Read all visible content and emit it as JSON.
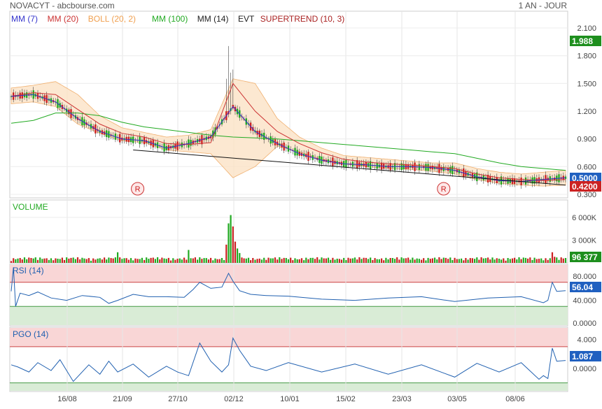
{
  "header": {
    "title": "NOVACYT - abcbourse.com",
    "period": "1 AN - JOUR"
  },
  "indicators": [
    {
      "label": "MM (7)",
      "color": "#3333cc"
    },
    {
      "label": "MM (20)",
      "color": "#cc3333"
    },
    {
      "label": "BOLL (20, 2)",
      "color": "#f0a050"
    },
    {
      "label": "MM (100)",
      "color": "#22aa22"
    },
    {
      "label": "MM (14)",
      "color": "#222222"
    },
    {
      "label": "EVT",
      "color": "#222222"
    },
    {
      "label": "SUPERTREND (10, 3)",
      "color": "#aa2222"
    }
  ],
  "markers": {
    "r_label": "R"
  },
  "chart_data": [
    {
      "type": "line",
      "panel": "price",
      "x_ticks": [
        "16/08",
        "21/09",
        "27/10",
        "02/12",
        "10/01",
        "15/02",
        "23/03",
        "03/05",
        "08/06"
      ],
      "y_ticks": [
        "2.100",
        "1.800",
        "1.500",
        "1.200",
        "0.900",
        "0.600",
        "0.300"
      ],
      "ylim": [
        0.3,
        2.1
      ],
      "last_badges": [
        {
          "value": "1.988",
          "color": "#1e8f1e"
        },
        {
          "value": "0.5000",
          "color": "#2060c0"
        },
        {
          "value": "0.4200",
          "color": "#cc2222"
        }
      ],
      "series": [
        {
          "name": "MM (7)",
          "x": [
            0,
            10,
            20,
            30,
            40,
            50,
            60,
            70,
            80,
            90,
            100,
            110,
            120,
            130,
            140,
            150,
            160,
            170,
            180,
            190,
            200,
            210,
            220,
            230,
            240,
            250
          ],
          "values": [
            1.36,
            1.38,
            1.3,
            1.12,
            0.98,
            0.9,
            0.88,
            0.8,
            0.85,
            0.92,
            1.25,
            0.98,
            0.85,
            0.74,
            0.67,
            0.63,
            0.62,
            0.6,
            0.6,
            0.59,
            0.56,
            0.49,
            0.45,
            0.44,
            0.46,
            0.48
          ]
        },
        {
          "name": "MM (20)",
          "x": [
            0,
            10,
            20,
            30,
            40,
            50,
            60,
            70,
            80,
            90,
            100,
            110,
            120,
            130,
            140,
            150,
            160,
            170,
            180,
            190,
            200,
            210,
            220,
            230,
            240,
            250
          ],
          "values": [
            1.36,
            1.4,
            1.38,
            1.22,
            1.06,
            0.96,
            0.92,
            0.85,
            0.84,
            0.86,
            1.5,
            1.2,
            0.98,
            0.85,
            0.75,
            0.68,
            0.65,
            0.63,
            0.62,
            0.6,
            0.58,
            0.52,
            0.48,
            0.46,
            0.45,
            0.46
          ]
        },
        {
          "name": "MM (100)",
          "x": [
            0,
            10,
            20,
            30,
            40,
            50,
            60,
            70,
            80,
            90,
            100,
            110,
            120,
            130,
            140,
            150,
            160,
            170,
            180,
            190,
            200,
            210,
            220,
            230,
            240,
            250
          ],
          "values": [
            1.07,
            1.1,
            1.18,
            1.18,
            1.15,
            1.08,
            1.03,
            1.0,
            0.97,
            0.94,
            0.92,
            0.91,
            0.9,
            0.88,
            0.86,
            0.84,
            0.82,
            0.8,
            0.78,
            0.76,
            0.74,
            0.69,
            0.64,
            0.6,
            0.58,
            0.56
          ]
        },
        {
          "name": "BOLL upper",
          "x": [
            0,
            10,
            20,
            30,
            40,
            50,
            60,
            70,
            80,
            90,
            100,
            110,
            120,
            130,
            140,
            150,
            160,
            170,
            180,
            190,
            200,
            210,
            220,
            230,
            240,
            250
          ],
          "values": [
            1.45,
            1.48,
            1.52,
            1.38,
            1.15,
            1.02,
            0.97,
            0.92,
            0.94,
            1.0,
            1.55,
            1.5,
            1.12,
            0.92,
            0.8,
            0.72,
            0.7,
            0.68,
            0.66,
            0.64,
            0.64,
            0.58,
            0.54,
            0.52,
            0.54,
            0.56
          ]
        },
        {
          "name": "BOLL lower",
          "x": [
            0,
            10,
            20,
            30,
            40,
            50,
            60,
            70,
            80,
            90,
            100,
            110,
            120,
            130,
            140,
            150,
            160,
            170,
            180,
            190,
            200,
            210,
            220,
            230,
            240,
            250
          ],
          "values": [
            1.28,
            1.3,
            1.25,
            1.06,
            0.96,
            0.88,
            0.86,
            0.78,
            0.76,
            0.74,
            0.48,
            0.6,
            0.82,
            0.76,
            0.68,
            0.63,
            0.6,
            0.58,
            0.57,
            0.55,
            0.52,
            0.46,
            0.42,
            0.4,
            0.39,
            0.4
          ]
        },
        {
          "name": "Trend",
          "x": [
            55,
            250
          ],
          "values": [
            0.78,
            0.4
          ]
        }
      ]
    },
    {
      "type": "bar",
      "panel": "volume",
      "title": "VOLUME",
      "y_ticks": [
        "6 000K",
        "3 000K"
      ],
      "ylim": [
        0,
        7000
      ],
      "last_value": "96 377",
      "last_color": "#1e8f1e",
      "spikes": [
        {
          "x": 48,
          "value": 1400
        },
        {
          "x": 97,
          "value": 2400
        },
        {
          "x": 98,
          "value": 5200
        },
        {
          "x": 99,
          "value": 6300
        },
        {
          "x": 100,
          "value": 4800
        },
        {
          "x": 101,
          "value": 2800
        },
        {
          "x": 102,
          "value": 1900
        },
        {
          "x": 103,
          "value": 1300
        },
        {
          "x": 80,
          "value": 1700
        },
        {
          "x": 244,
          "value": 1400
        },
        {
          "x": 245,
          "value": 800
        }
      ]
    },
    {
      "type": "line",
      "panel": "rsi",
      "title": "RSI (14)",
      "y_ticks": [
        "80.000",
        "40.000",
        "0.0000"
      ],
      "ylim": [
        0,
        100
      ],
      "levels": [
        70,
        30
      ],
      "last_value": "56.04",
      "last_color": "#2060c0",
      "x": [
        0,
        1,
        2,
        4,
        8,
        12,
        18,
        25,
        32,
        40,
        44,
        48,
        55,
        62,
        70,
        78,
        82,
        85,
        90,
        95,
        98,
        100,
        103,
        108,
        115,
        125,
        140,
        155,
        170,
        185,
        200,
        215,
        230,
        240,
        242,
        244,
        246,
        250
      ],
      "values": [
        55,
        95,
        30,
        52,
        48,
        54,
        44,
        40,
        48,
        45,
        35,
        40,
        50,
        46,
        46,
        45,
        58,
        70,
        60,
        62,
        85,
        72,
        56,
        50,
        48,
        47,
        42,
        40,
        44,
        46,
        38,
        44,
        46,
        36,
        40,
        70,
        55,
        56
      ]
    },
    {
      "type": "line",
      "panel": "pgo",
      "title": "PGO (14)",
      "y_ticks": [
        "4.000",
        "0.0000"
      ],
      "ylim": [
        -3,
        5.5
      ],
      "levels": [
        3,
        -2
      ],
      "last_value": "1.087",
      "last_color": "#2060c0",
      "x": [
        0,
        3,
        8,
        12,
        18,
        22,
        28,
        35,
        40,
        44,
        48,
        55,
        62,
        70,
        75,
        80,
        85,
        90,
        95,
        98,
        100,
        103,
        108,
        115,
        125,
        140,
        155,
        170,
        185,
        200,
        210,
        220,
        230,
        238,
        240,
        242,
        244,
        246,
        250
      ],
      "values": [
        0.5,
        0.2,
        -0.5,
        0.8,
        -0.3,
        1.2,
        -1.8,
        0.5,
        -0.8,
        1.0,
        -0.5,
        0.6,
        -1.2,
        0.3,
        -0.5,
        -1.0,
        3.5,
        1.0,
        -0.5,
        0.5,
        4.2,
        2.5,
        0.3,
        -0.3,
        0.8,
        -0.5,
        0.6,
        -0.8,
        0.5,
        -1.2,
        0.7,
        -0.5,
        0.8,
        -1.5,
        -1.0,
        -1.4,
        2.8,
        1.0,
        1.1
      ]
    }
  ]
}
